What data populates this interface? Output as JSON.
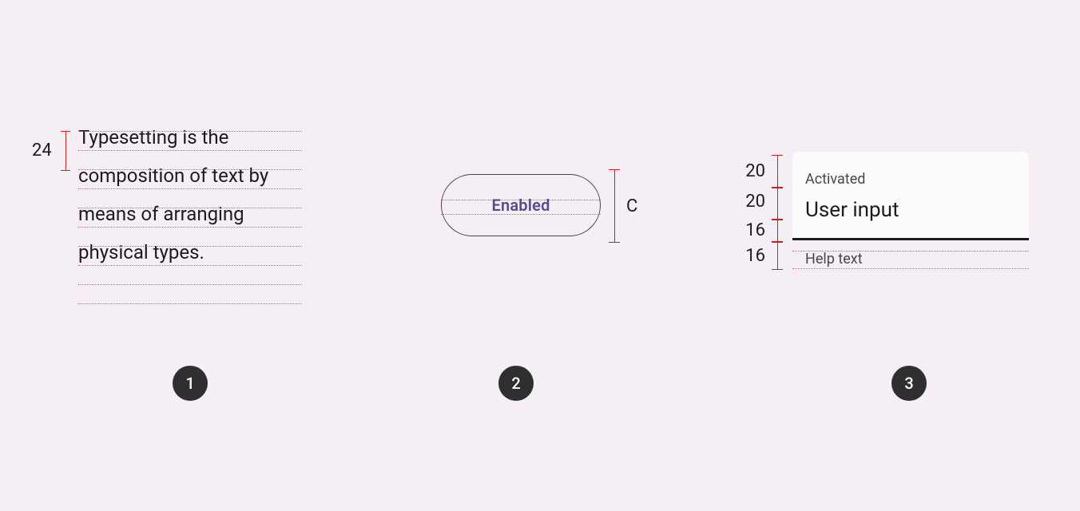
{
  "panel1": {
    "paragraph": "Typesetting is the composition of text by means of arranging physical types.",
    "line_height_spec": "24"
  },
  "panel2": {
    "button_label": "Enabled",
    "height_spec": "C"
  },
  "panel3": {
    "field_label": "Activated",
    "field_value": "User input",
    "help_text": "Help text",
    "specs": {
      "label_line": "20",
      "value_line": "20",
      "underline_gap": "16",
      "help_line": "16"
    }
  },
  "badges": {
    "b1": "1",
    "b2": "2",
    "b3": "3"
  }
}
